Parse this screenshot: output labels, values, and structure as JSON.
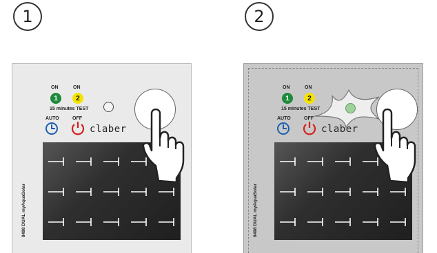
{
  "steps": [
    "1",
    "2"
  ],
  "panel": {
    "on_label": "ON",
    "led1": "1",
    "led2": "2",
    "test_label": "15 minutes TEST",
    "auto_label": "AUTO",
    "off_label": "OFF",
    "brand": "claber",
    "model_text": "8498 DUAL myAquaSolar"
  },
  "colors": {
    "green_led": "#1f8a3c",
    "yellow_led": "#f4e300",
    "auto_icon": "#1b5fb0",
    "off_icon": "#d42020",
    "indicator_glow": "#9fd19a"
  },
  "icons": [
    "clock-icon",
    "power-icon",
    "hand-pointer-icon"
  ]
}
